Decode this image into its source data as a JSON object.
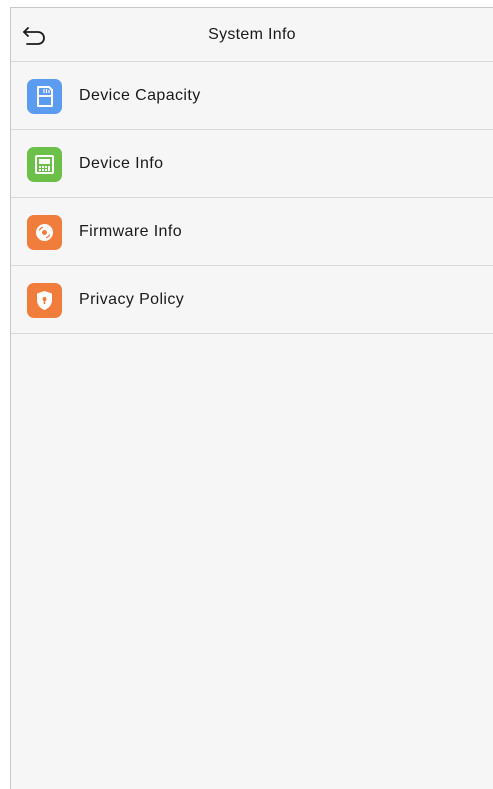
{
  "header": {
    "title": "System Info",
    "back_icon": "back-arrow-icon"
  },
  "menu": {
    "items": [
      {
        "label": "Device Capacity",
        "icon": "sd-card-icon",
        "color": "#5b9bf0"
      },
      {
        "label": "Device Info",
        "icon": "device-icon",
        "color": "#6cc04a"
      },
      {
        "label": "Firmware Info",
        "icon": "disc-icon",
        "color": "#f07d3c"
      },
      {
        "label": "Privacy Policy",
        "icon": "shield-icon",
        "color": "#f07d3c"
      }
    ]
  },
  "colors": {
    "background": "#f6f6f6",
    "divider": "#d9d9d9",
    "text": "#1a1a1a"
  }
}
